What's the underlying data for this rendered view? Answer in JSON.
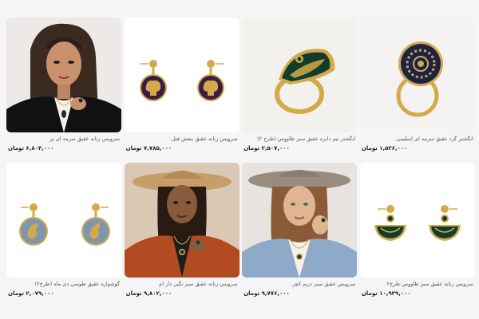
{
  "products": [
    {
      "title": "سرویس زنانه عقیق سرمه ای پر",
      "price": "۶,۸۰۴,۰۰۰ تومان",
      "image": "model-navy-agate-set"
    },
    {
      "title": "سرویس زنانه عقیق بنفش فیل",
      "price": "۷,۷۸۵,۰۰۰ تومان",
      "image": "purple-elephant-earrings"
    },
    {
      "title": "انگشتر نیم دایره عقیق سبز طاووس (طرح ۲)",
      "price": "۲,۵۰۷,۰۰۰ تومان",
      "image": "green-peacock-ring"
    },
    {
      "title": "انگشتر گرد عقیق سرمه ای اسلیمی",
      "price": "۱,۵۳۶,۰۰۰ تومان",
      "image": "navy-round-ring"
    },
    {
      "title": "گوشواره عقیق طوسی دی ماه (طرح۲)",
      "price": "۲,۰۷۹,۰۰۰ تومان",
      "image": "gray-capricorn-earrings"
    },
    {
      "title": "سرویس زنانه عقیق سبز نگین دار ام",
      "price": "۹,۸۰۲,۰۰۰ تومان",
      "image": "model-green-agate-set"
    },
    {
      "title": "سرویس عقیق سبز دریم کچر",
      "price": "۹,۷۷۶,۰۰۰ تومان",
      "image": "model-dreamcatcher-set"
    },
    {
      "title": "سرویس زنانه عقیق سبز طاووس طرح۲",
      "price": "۱۰,۹۳۹,۰۰۰ تومان",
      "image": "green-peacock-earrings"
    }
  ],
  "colors": {
    "background": "#f5f5f7",
    "gold": "#d4a94a",
    "navy": "#1d2347",
    "purple": "#3a1c46",
    "green": "#123d2c",
    "gray_agate": "#7f97ad"
  }
}
